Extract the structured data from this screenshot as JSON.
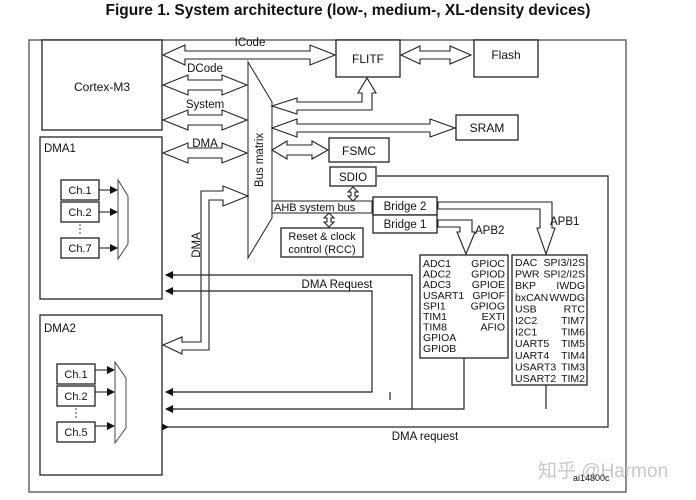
{
  "title": "Figure 1. System architecture (low-, medium-, XL-density devices)",
  "blocks": {
    "cortex": "Cortex-M3",
    "flitf": "FLITF",
    "flash": "Flash",
    "sram": "SRAM",
    "fsmc": "FSMC",
    "sdio": "SDIO",
    "bus_matrix": "Bus matrix",
    "ahb": "AHB system bus",
    "bridge2": "Bridge  2",
    "bridge1": "Bridge  1",
    "rcc_line1": "Reset & clock",
    "rcc_line2": "control (RCC)",
    "dma1": "DMA1",
    "dma2": "DMA2"
  },
  "buses": {
    "icode": "ICode",
    "dcode": "DCode",
    "system": "System",
    "dma": "DMA",
    "dma_vertical": "DMA",
    "apb2": "APB2",
    "apb1": "APB1",
    "dma_request_upper": "DMA Request",
    "dma_request_lower": "DMA request"
  },
  "dma1_channels": [
    "Ch.1",
    "Ch.2",
    "Ch.7"
  ],
  "dma2_channels": [
    "Ch.1",
    "Ch.2",
    "Ch.5"
  ],
  "apb2_peripherals": {
    "left": [
      "ADC1",
      "ADC2",
      "ADC3",
      "USART1",
      "SPI1",
      "TIM1",
      "TIM8",
      "GPIOA",
      "GPIOB"
    ],
    "right": [
      "GPIOC",
      "GPIOD",
      "GPIOE",
      "GPIOF",
      "GPIOG",
      "EXTI",
      "AFIO"
    ]
  },
  "apb1_peripherals": {
    "left": [
      "DAC",
      "PWR",
      "BKP",
      "bxCAN",
      "USB",
      "I2C2",
      "I2C1",
      "UART5",
      "UART4",
      "USART3",
      "USART2"
    ],
    "right": [
      "SPI3/I2S",
      "SPI2/I2S",
      "IWDG",
      "WWDG",
      "RTC",
      "TIM7",
      "TIM6",
      "TIM5",
      "TIM4",
      "TIM3",
      "TIM2"
    ]
  },
  "figure_id": "ai14800c",
  "watermark": "知乎 @Harmon"
}
